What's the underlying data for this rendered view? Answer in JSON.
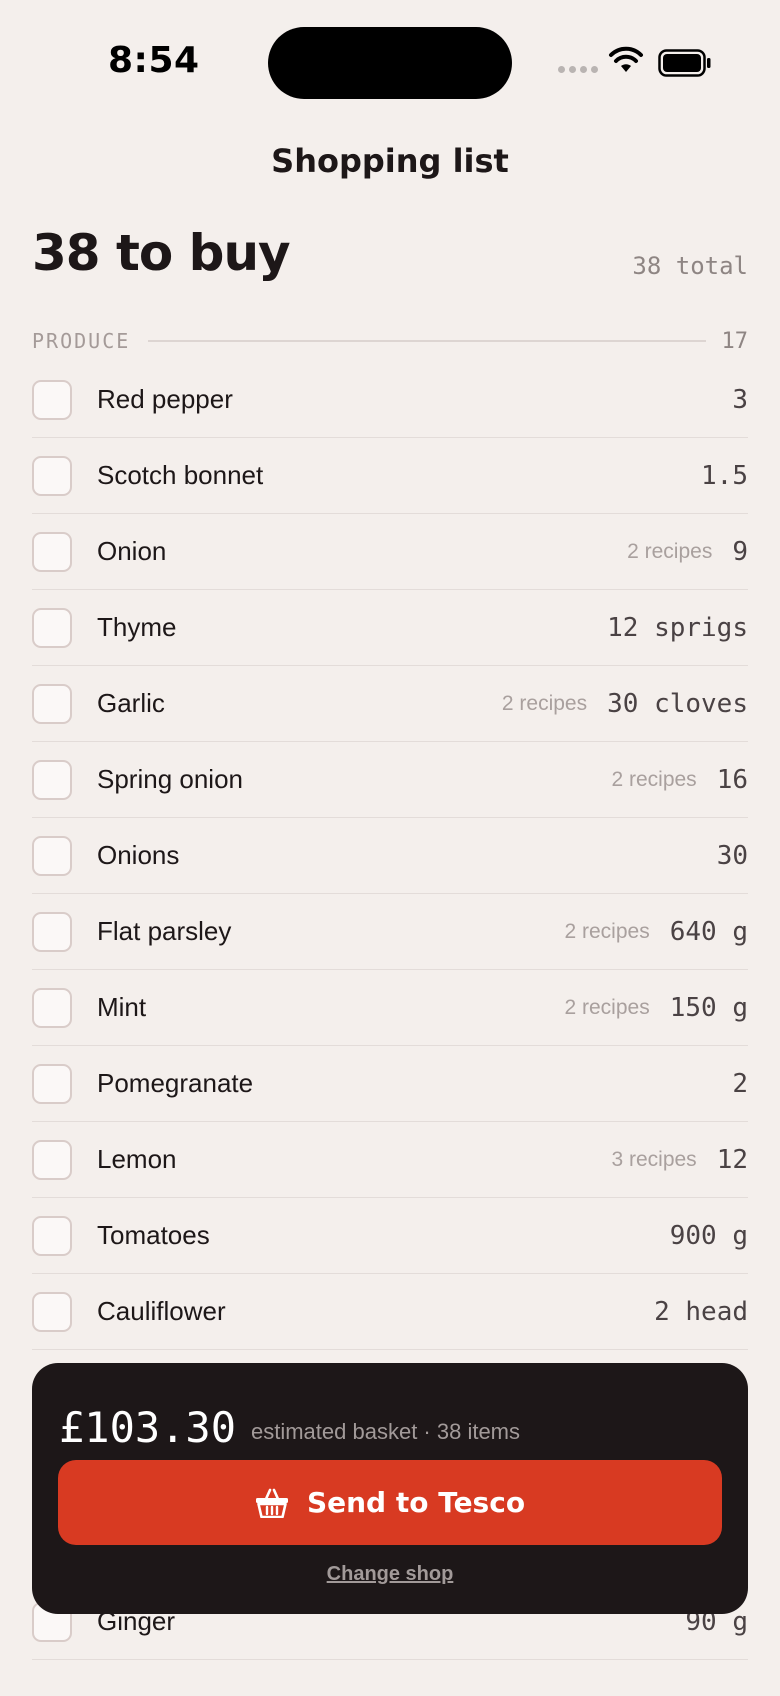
{
  "status_bar": {
    "time": "8:54"
  },
  "nav": {
    "title": "Shopping list"
  },
  "summary": {
    "headline": "38 to buy",
    "total": "38 total"
  },
  "section": {
    "label": "PRODUCE",
    "count": "17"
  },
  "items": [
    {
      "name": "Red pepper",
      "recipes": "",
      "qty": "3"
    },
    {
      "name": "Scotch bonnet",
      "recipes": "",
      "qty": "1.5"
    },
    {
      "name": "Onion",
      "recipes": "2 recipes",
      "qty": "9"
    },
    {
      "name": "Thyme",
      "recipes": "",
      "qty": "12 sprigs"
    },
    {
      "name": "Garlic",
      "recipes": "2 recipes",
      "qty": "30 cloves"
    },
    {
      "name": "Spring onion",
      "recipes": "2 recipes",
      "qty": "16"
    },
    {
      "name": "Onions",
      "recipes": "",
      "qty": "30"
    },
    {
      "name": "Flat parsley",
      "recipes": "2 recipes",
      "qty": "640 g"
    },
    {
      "name": "Mint",
      "recipes": "2 recipes",
      "qty": "150 g"
    },
    {
      "name": "Pomegranate",
      "recipes": "",
      "qty": "2"
    },
    {
      "name": "Lemon",
      "recipes": "3 recipes",
      "qty": "12"
    },
    {
      "name": "Tomatoes",
      "recipes": "",
      "qty": "900 g"
    },
    {
      "name": "Cauliflower",
      "recipes": "",
      "qty": "2 head"
    }
  ],
  "partial_item": {
    "name": "Ginger",
    "qty": "90 g"
  },
  "basket": {
    "price": "£103.30",
    "note": "estimated basket · 38 items",
    "send_label": "Send to Tesco",
    "change_shop_label": "Change shop"
  },
  "colors": {
    "accent": "#d83a22",
    "card": "#1d1718",
    "background": "#f4efec"
  }
}
